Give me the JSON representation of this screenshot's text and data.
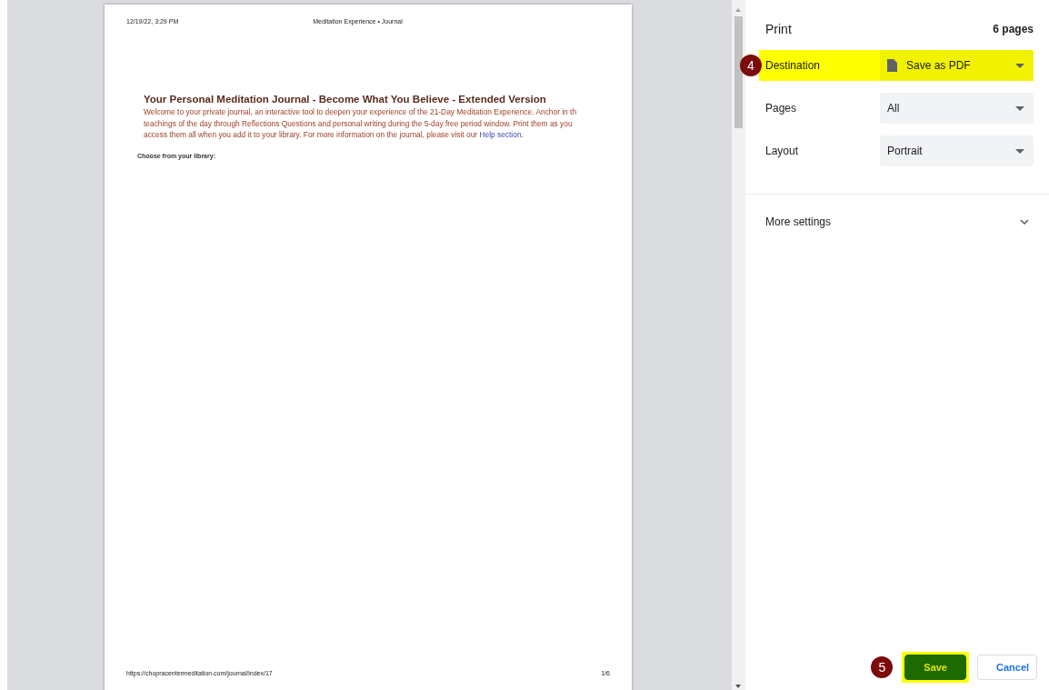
{
  "preview": {
    "header_left": "12/19/22, 3:29 PM",
    "header_center": "Meditation Experience • Journal",
    "heading": "Your Personal Meditation Journal - Become What You Believe - Extended Version",
    "intro_lines": [
      {
        "text": "Welcome to your private journal, an interactive tool to deepen your experience of the 21-Day Meditation Experience. Anchor in th"
      },
      {
        "text": "teachings of the day through Reflections Questions and personal writing during the 5-day free period window. Print them as you "
      },
      {
        "text": "access them all when you add it to your library. For more information on the journal, please visit our ",
        "link": "Help section",
        "after": "."
      }
    ],
    "subheading": "Choose from your library:",
    "footer_left": "https://chopracentermeditation.com/journal/index/17",
    "footer_right": "1/6"
  },
  "settings": {
    "title": "Print",
    "page_count": "6 pages",
    "rows": [
      {
        "kind": "destination",
        "label": "Destination",
        "value": "Save as PDF",
        "highlighted": true,
        "step": "4"
      },
      {
        "kind": "select",
        "label": "Pages",
        "value": "All",
        "highlighted": false
      },
      {
        "kind": "select",
        "label": "Layout",
        "value": "Portrait",
        "highlighted": false
      }
    ],
    "more_settings": {
      "label": "More settings",
      "expanded": false
    },
    "buttons": [
      {
        "kind": "primary",
        "label": "Save",
        "highlighted": true,
        "step": "5"
      },
      {
        "kind": "secondary",
        "label": "Cancel",
        "highlighted": false
      }
    ]
  }
}
